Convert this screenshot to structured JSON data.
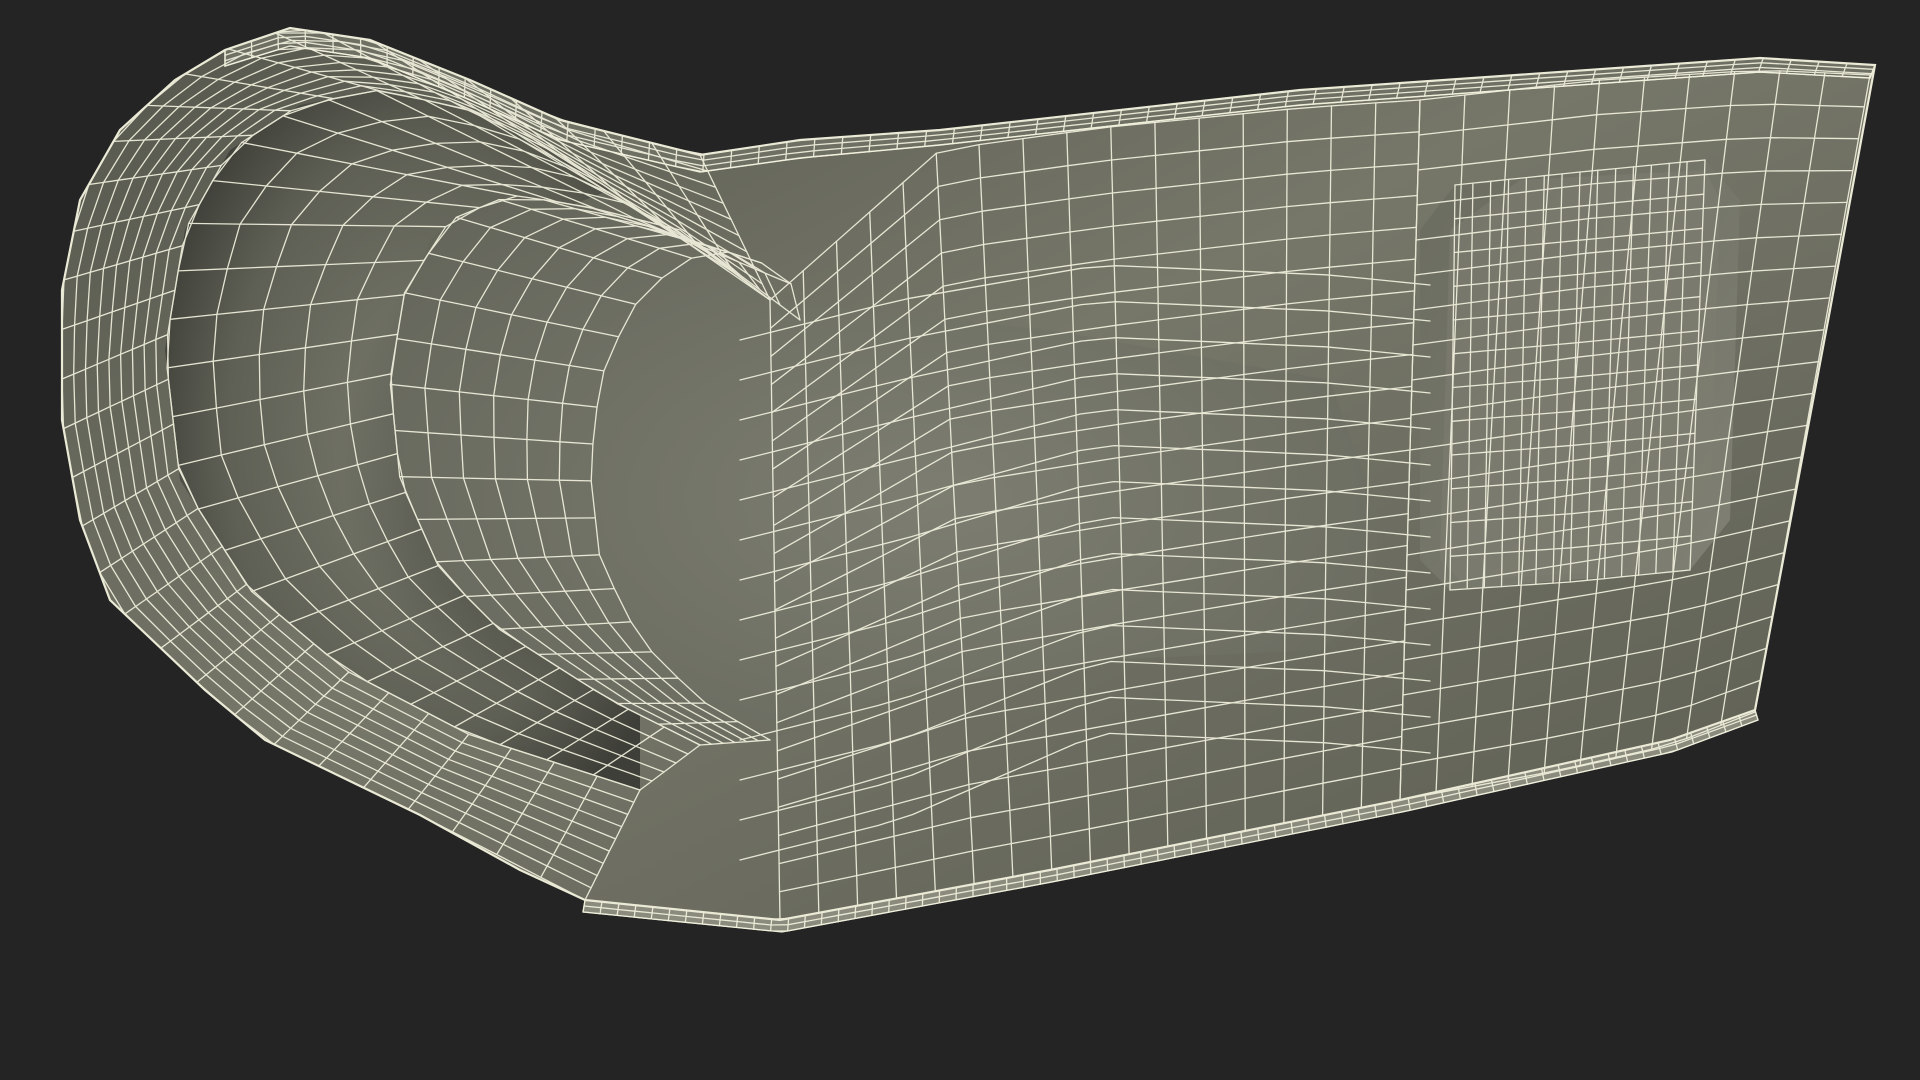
{
  "scene": {
    "subject": "wireframe-3d-model",
    "colors": {
      "background": "#242424",
      "surface_light": "#7c7d70",
      "surface_mid": "#6a6b5f",
      "surface_dark": "#3f403a",
      "wire": "#f2f1de",
      "rim": "#d9d8c6"
    }
  }
}
